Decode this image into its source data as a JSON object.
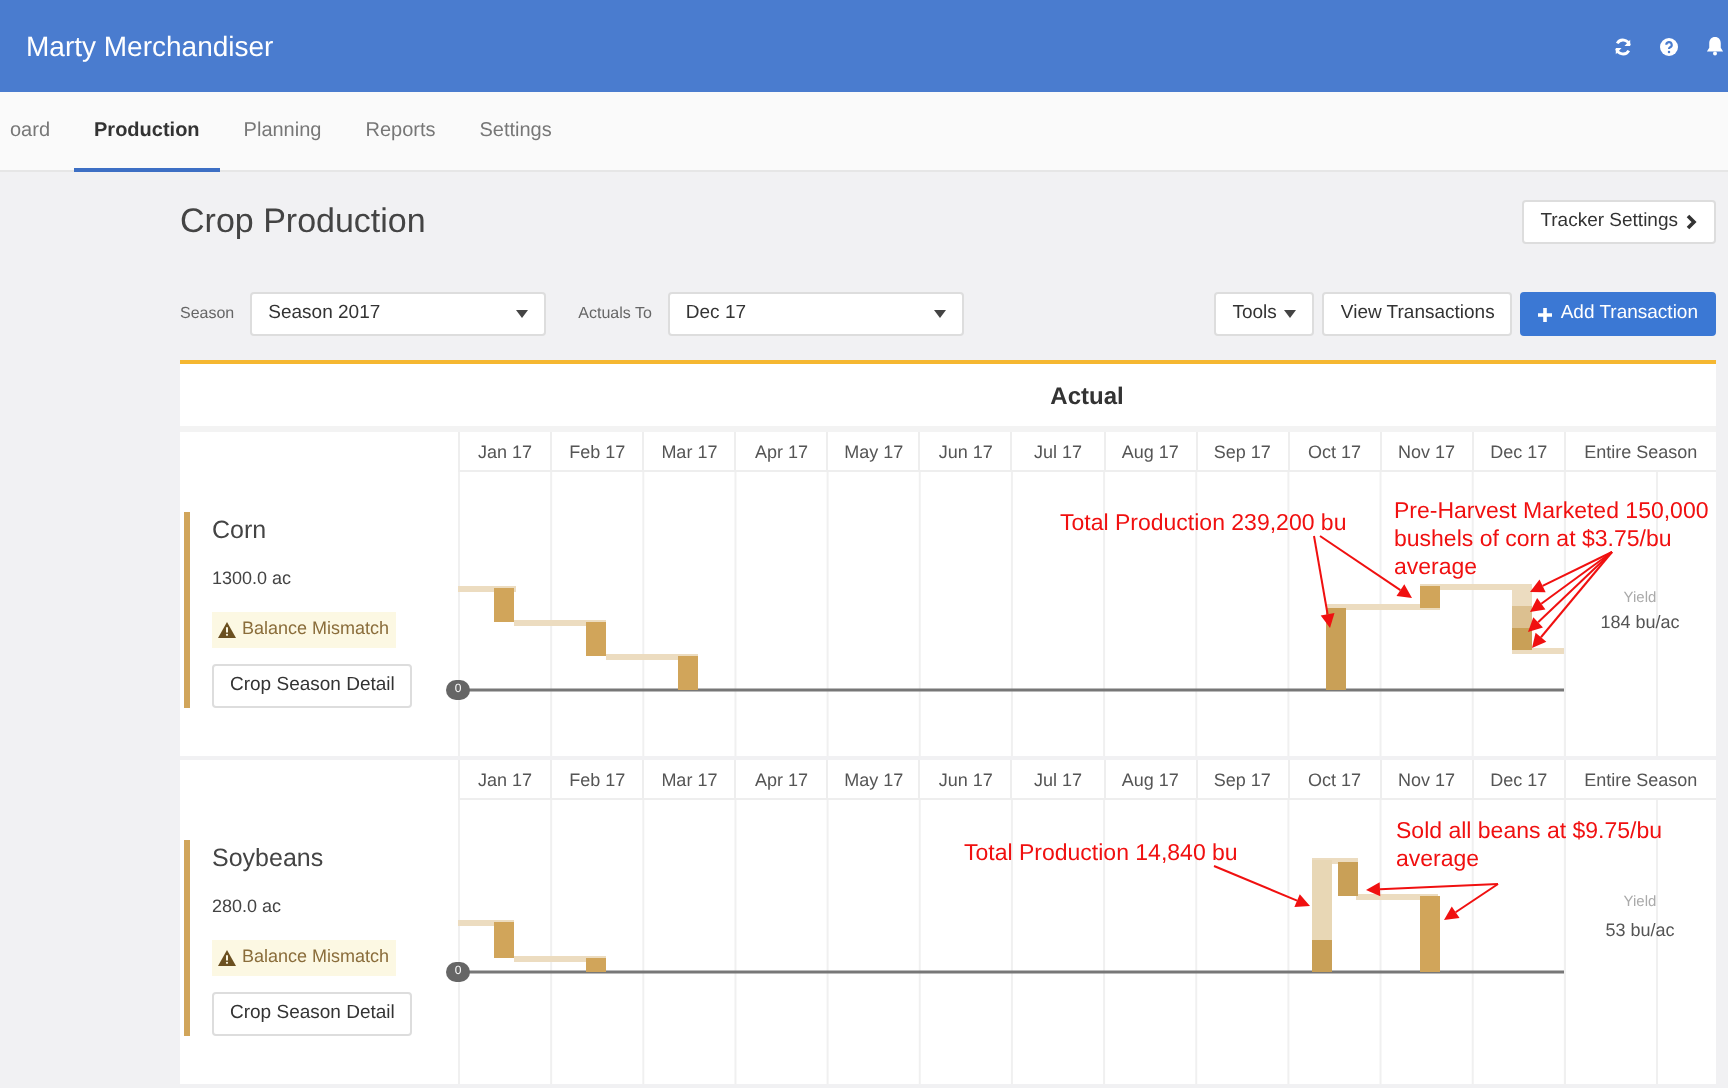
{
  "app": {
    "title": "Marty Merchandiser"
  },
  "nav_tabs": [
    {
      "label": "oard",
      "selected": false
    },
    {
      "label": "Production",
      "selected": true
    },
    {
      "label": "Planning",
      "selected": false
    },
    {
      "label": "Reports",
      "selected": false
    },
    {
      "label": "Settings",
      "selected": false
    }
  ],
  "page": {
    "title": "Crop Production",
    "tracker_button": "Tracker Settings"
  },
  "filters": [
    {
      "label": "Season",
      "value": "Season 2017"
    },
    {
      "label": "Actuals To",
      "value": "Dec 17"
    }
  ],
  "toolbar": {
    "tools": "Tools",
    "view": "View Transactions",
    "add": "Add Transaction"
  },
  "section_title": "Actual",
  "crops": [
    {
      "name": "Corn",
      "acres": "1300.0 ac",
      "warning": "Balance Mismatch",
      "detail_button": "Crop Season Detail",
      "axis_zero": "0",
      "yield_label": "Yield",
      "yield": "184 bu/ac",
      "months": [
        "Jan 17",
        "Feb 17",
        "Mar 17",
        "Apr 17",
        "May 17",
        "Jun 17",
        "Jul 17",
        "Aug 17",
        "Sep 17",
        "Oct 17",
        "Nov 17",
        "Dec 17",
        "Entire Season"
      ],
      "annotations": [
        "Total Production 239,200 bu",
        "Pre-Harvest Marketed 150,000 bushels of corn at $3.75/bu average"
      ]
    },
    {
      "name": "Soybeans",
      "acres": "280.0 ac",
      "warning": "Balance Mismatch",
      "detail_button": "Crop Season Detail",
      "axis_zero": "0",
      "yield_label": "Yield",
      "yield": "53 bu/ac",
      "months": [
        "Jan 17",
        "Feb 17",
        "Mar 17",
        "Apr 17",
        "May 17",
        "Jun 17",
        "Jul 17",
        "Aug 17",
        "Sep 17",
        "Oct 17",
        "Nov 17",
        "Dec 17",
        "Entire Season"
      ],
      "annotations": [
        "Total Production 14,840 bu",
        "Sold all beans at $9.75/bu average"
      ]
    }
  ]
}
